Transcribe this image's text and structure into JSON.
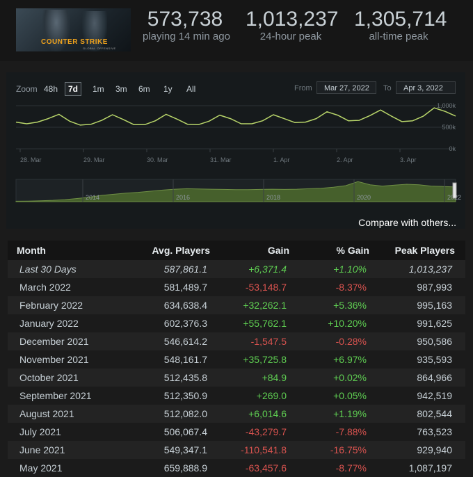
{
  "header": {
    "logo_text": "COUNTER STRIKE",
    "logo_subtext": "GLOBAL OFFENSIVE",
    "stats": [
      {
        "value": "573,738",
        "label": "playing 14 min ago"
      },
      {
        "value": "1,013,237",
        "label": "24-hour peak"
      },
      {
        "value": "1,305,714",
        "label": "all-time peak"
      }
    ]
  },
  "chart_controls": {
    "zoom_label": "Zoom",
    "zoom_options": [
      "48h",
      "7d",
      "1m",
      "3m",
      "6m",
      "1y",
      "All"
    ],
    "active_zoom": "7d",
    "from_label": "From",
    "from_value": "Mar 27, 2022",
    "to_label": "To",
    "to_value": "Apr 3, 2022"
  },
  "chart_data": [
    {
      "type": "line",
      "x_tick_labels": [
        "28. Mar",
        "29. Mar",
        "30. Mar",
        "31. Mar",
        "1. Apr",
        "2. Apr",
        "3. Apr"
      ],
      "y_tick_labels": [
        "1,000k",
        "500k",
        "0k"
      ],
      "ylim": [
        0,
        1000000
      ],
      "series": [
        {
          "values": [
            620000,
            580000,
            620000,
            700000,
            800000,
            640000,
            550000,
            570000,
            660000,
            790000,
            680000,
            560000,
            560000,
            650000,
            800000,
            690000,
            570000,
            560000,
            640000,
            780000,
            700000,
            580000,
            580000,
            650000,
            790000,
            700000,
            610000,
            620000,
            700000,
            860000,
            780000,
            650000,
            660000,
            770000,
            900000,
            760000,
            630000,
            650000,
            760000,
            950000,
            870000,
            760000
          ]
        }
      ],
      "accent_color": "#b8d56a"
    },
    {
      "type": "area",
      "x_tick_labels": [
        "2014",
        "2016",
        "2018",
        "2020",
        "2022"
      ],
      "series": [
        {
          "values": [
            20000,
            25000,
            40000,
            60000,
            90000,
            140000,
            200000,
            280000,
            330000,
            380000,
            420000,
            470000,
            520000,
            560000,
            580000,
            570000,
            560000,
            550000,
            540000,
            540000,
            550000,
            560000,
            550000,
            560000,
            580000,
            600000,
            650000,
            720000,
            900000,
            760000,
            700000,
            740000,
            780000,
            760000,
            700000,
            680000,
            660000
          ]
        }
      ],
      "accent_color": "#4e6b2e"
    }
  ],
  "compare_link": "Compare with others...",
  "table": {
    "headers": [
      "Month",
      "Avg. Players",
      "Gain",
      "% Gain",
      "Peak Players"
    ],
    "rows": [
      {
        "month": "Last 30 Days",
        "avg": "587,861.1",
        "gain": "+6,371.4",
        "pct": "+1.10%",
        "peak": "1,013,237",
        "sign": "pos",
        "italic": true
      },
      {
        "month": "March 2022",
        "avg": "581,489.7",
        "gain": "-53,148.7",
        "pct": "-8.37%",
        "peak": "987,993",
        "sign": "neg"
      },
      {
        "month": "February 2022",
        "avg": "634,638.4",
        "gain": "+32,262.1",
        "pct": "+5.36%",
        "peak": "995,163",
        "sign": "pos"
      },
      {
        "month": "January 2022",
        "avg": "602,376.3",
        "gain": "+55,762.1",
        "pct": "+10.20%",
        "peak": "991,625",
        "sign": "pos"
      },
      {
        "month": "December 2021",
        "avg": "546,614.2",
        "gain": "-1,547.5",
        "pct": "-0.28%",
        "peak": "950,586",
        "sign": "neg"
      },
      {
        "month": "November 2021",
        "avg": "548,161.7",
        "gain": "+35,725.8",
        "pct": "+6.97%",
        "peak": "935,593",
        "sign": "pos"
      },
      {
        "month": "October 2021",
        "avg": "512,435.8",
        "gain": "+84.9",
        "pct": "+0.02%",
        "peak": "864,966",
        "sign": "pos"
      },
      {
        "month": "September 2021",
        "avg": "512,350.9",
        "gain": "+269.0",
        "pct": "+0.05%",
        "peak": "942,519",
        "sign": "pos"
      },
      {
        "month": "August 2021",
        "avg": "512,082.0",
        "gain": "+6,014.6",
        "pct": "+1.19%",
        "peak": "802,544",
        "sign": "pos"
      },
      {
        "month": "July 2021",
        "avg": "506,067.4",
        "gain": "-43,279.7",
        "pct": "-7.88%",
        "peak": "763,523",
        "sign": "neg"
      },
      {
        "month": "June 2021",
        "avg": "549,347.1",
        "gain": "-110,541.8",
        "pct": "-16.75%",
        "peak": "929,940",
        "sign": "neg"
      },
      {
        "month": "May 2021",
        "avg": "659,888.9",
        "gain": "-63,457.6",
        "pct": "-8.77%",
        "peak": "1,087,197",
        "sign": "neg"
      }
    ]
  }
}
